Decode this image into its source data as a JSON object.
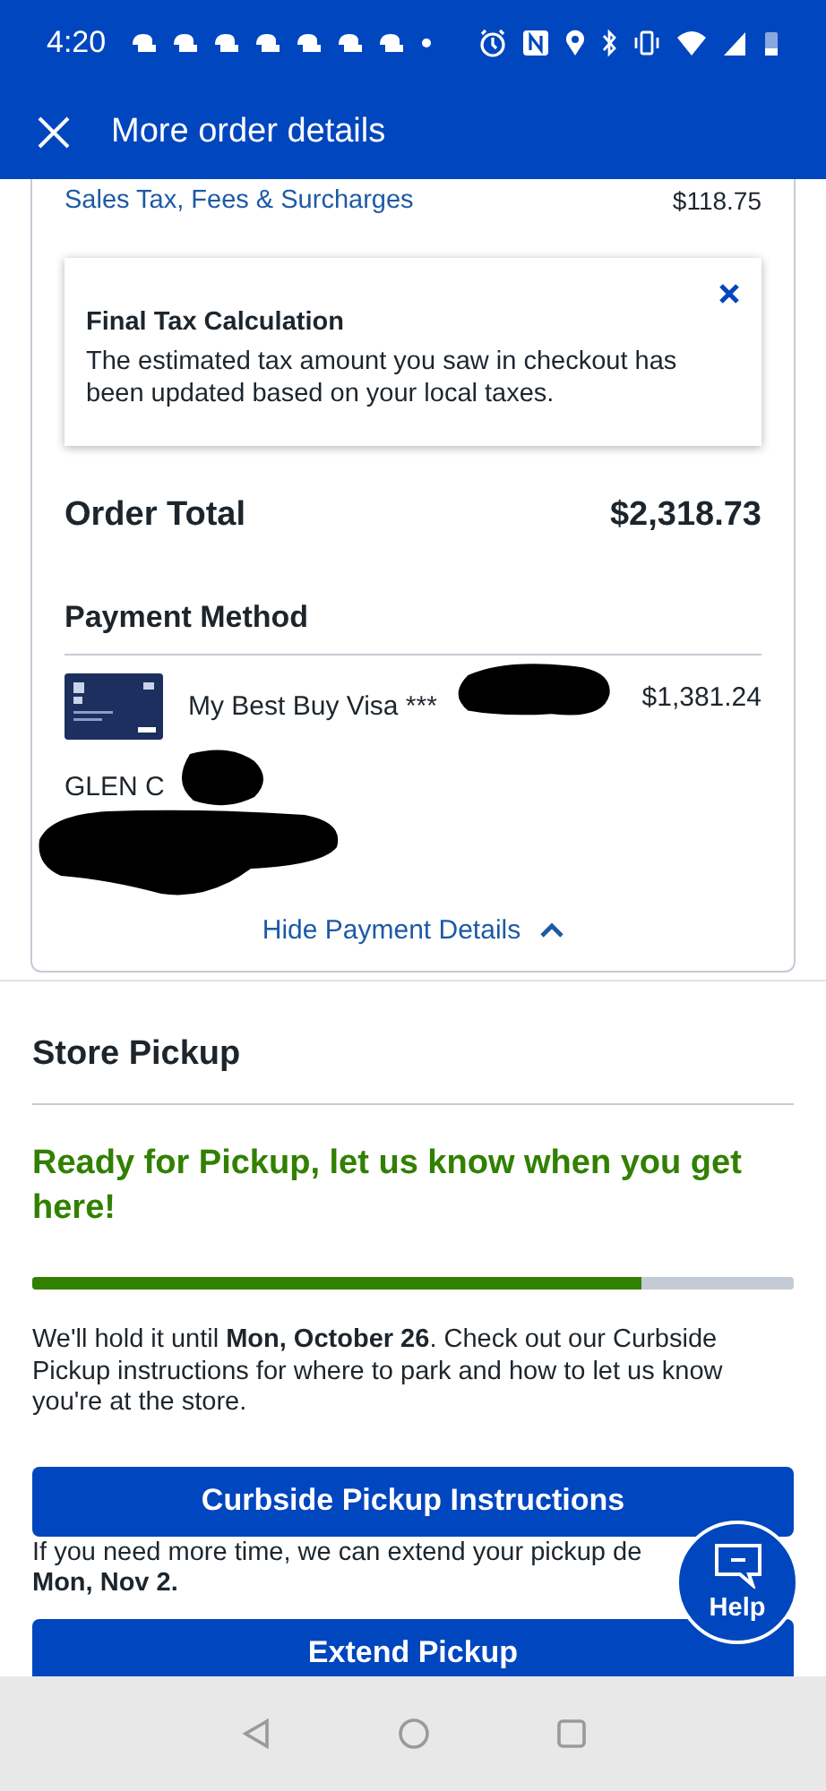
{
  "status_bar": {
    "time": "4:20"
  },
  "header": {
    "title": "More order details"
  },
  "summary": {
    "label": "Sales Tax, Fees & Surcharges",
    "value": "$118.75"
  },
  "notice": {
    "title": "Final Tax Calculation",
    "body": "The estimated tax amount you saw in checkout has been updated based on your local taxes."
  },
  "total": {
    "label": "Order Total",
    "value": "$2,318.73"
  },
  "payment": {
    "heading": "Payment Method",
    "card_name": "My Best Buy Visa ***",
    "amount": "$1,381.24",
    "holder": "GLEN C",
    "toggle": "Hide Payment Details",
    "expanded": true
  },
  "pickup": {
    "heading": "Store Pickup",
    "status": "Ready for Pickup, let us know when you get here!",
    "level": 0.8,
    "hold_text": "We'll hold it until **Mon, October 26**. Check out our Curbside Pickup instructions for where to park and how to let us know you're at the store.",
    "instructions_button": "Curbside Pickup Instructions",
    "extend_note": "If you need more time, we can extend your pickup de\n**Mon, Nov 2.**",
    "extend_button": "Extend Pickup"
  },
  "help": {
    "label": "Help"
  }
}
